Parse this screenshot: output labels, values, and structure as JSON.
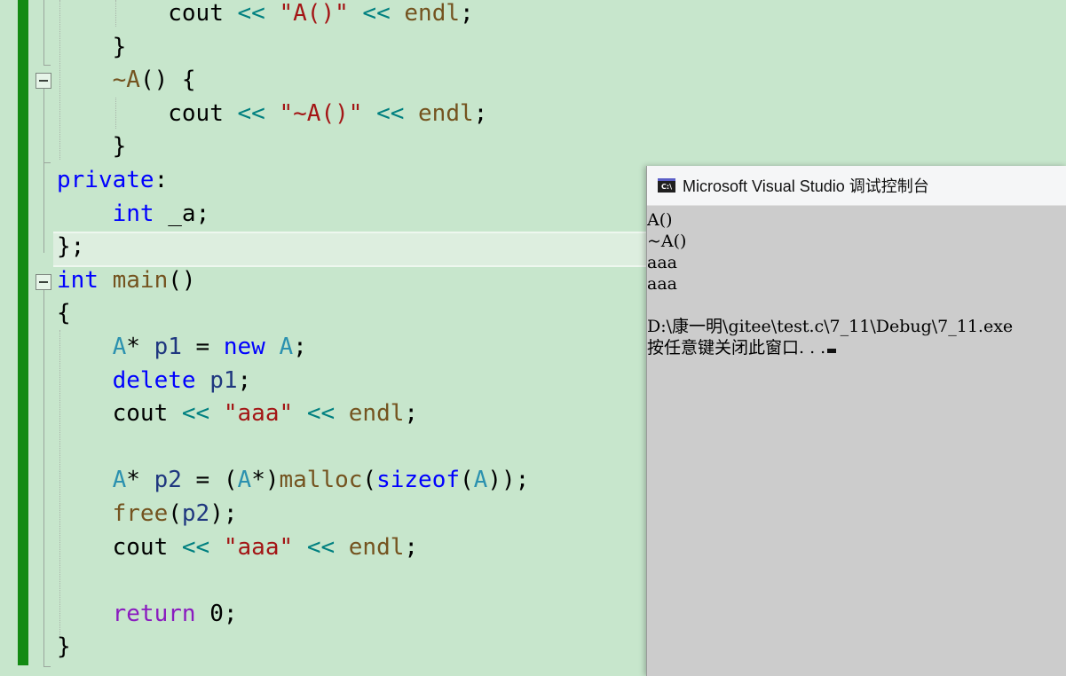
{
  "editor": {
    "lines": [
      [
        {
          "t": "        "
        },
        {
          "t": "cout",
          "c": ""
        },
        {
          "t": " "
        },
        {
          "t": "<<",
          "c": "op"
        },
        {
          "t": " "
        },
        {
          "t": "\"A()\"",
          "c": "str"
        },
        {
          "t": " "
        },
        {
          "t": "<<",
          "c": "op"
        },
        {
          "t": " "
        },
        {
          "t": "endl",
          "c": "fn"
        },
        {
          "t": ";"
        }
      ],
      [
        {
          "t": "    }"
        }
      ],
      [
        {
          "t": "    "
        },
        {
          "t": "~A",
          "c": "fn"
        },
        {
          "t": "() {"
        }
      ],
      [
        {
          "t": "        "
        },
        {
          "t": "cout"
        },
        {
          "t": " "
        },
        {
          "t": "<<",
          "c": "op"
        },
        {
          "t": " "
        },
        {
          "t": "\"~A()\"",
          "c": "str"
        },
        {
          "t": " "
        },
        {
          "t": "<<",
          "c": "op"
        },
        {
          "t": " "
        },
        {
          "t": "endl",
          "c": "fn"
        },
        {
          "t": ";"
        }
      ],
      [
        {
          "t": "    }"
        }
      ],
      [
        {
          "t": "private",
          "c": "kw"
        },
        {
          "t": ":"
        }
      ],
      [
        {
          "t": "    "
        },
        {
          "t": "int",
          "c": "kw"
        },
        {
          "t": " "
        },
        {
          "t": "_a",
          "c": ""
        },
        {
          "t": ";"
        }
      ],
      [
        {
          "t": "};"
        }
      ],
      [
        {
          "t": "int",
          "c": "kw"
        },
        {
          "t": " "
        },
        {
          "t": "main",
          "c": "fn"
        },
        {
          "t": "()"
        }
      ],
      [
        {
          "t": "{"
        }
      ],
      [
        {
          "t": "    "
        },
        {
          "t": "A",
          "c": "type"
        },
        {
          "t": "* "
        },
        {
          "t": "p1",
          "c": "var"
        },
        {
          "t": " = "
        },
        {
          "t": "new",
          "c": "kw"
        },
        {
          "t": " "
        },
        {
          "t": "A",
          "c": "type"
        },
        {
          "t": ";"
        }
      ],
      [
        {
          "t": "    "
        },
        {
          "t": "delete",
          "c": "kw"
        },
        {
          "t": " "
        },
        {
          "t": "p1",
          "c": "var"
        },
        {
          "t": ";"
        }
      ],
      [
        {
          "t": "    "
        },
        {
          "t": "cout"
        },
        {
          "t": " "
        },
        {
          "t": "<<",
          "c": "op"
        },
        {
          "t": " "
        },
        {
          "t": "\"aaa\"",
          "c": "str"
        },
        {
          "t": " "
        },
        {
          "t": "<<",
          "c": "op"
        },
        {
          "t": " "
        },
        {
          "t": "endl",
          "c": "fn"
        },
        {
          "t": ";"
        }
      ],
      [
        {
          "t": ""
        }
      ],
      [
        {
          "t": "    "
        },
        {
          "t": "A",
          "c": "type"
        },
        {
          "t": "* "
        },
        {
          "t": "p2",
          "c": "var"
        },
        {
          "t": " = ("
        },
        {
          "t": "A",
          "c": "type"
        },
        {
          "t": "*)"
        },
        {
          "t": "malloc",
          "c": "fn"
        },
        {
          "t": "("
        },
        {
          "t": "sizeof",
          "c": "kw"
        },
        {
          "t": "("
        },
        {
          "t": "A",
          "c": "type"
        },
        {
          "t": "));"
        }
      ],
      [
        {
          "t": "    "
        },
        {
          "t": "free",
          "c": "fn"
        },
        {
          "t": "("
        },
        {
          "t": "p2",
          "c": "var"
        },
        {
          "t": ");"
        }
      ],
      [
        {
          "t": "    "
        },
        {
          "t": "cout"
        },
        {
          "t": " "
        },
        {
          "t": "<<",
          "c": "op"
        },
        {
          "t": " "
        },
        {
          "t": "\"aaa\"",
          "c": "str"
        },
        {
          "t": " "
        },
        {
          "t": "<<",
          "c": "op"
        },
        {
          "t": " "
        },
        {
          "t": "endl",
          "c": "fn"
        },
        {
          "t": ";"
        }
      ],
      [
        {
          "t": ""
        }
      ],
      [
        {
          "t": "    "
        },
        {
          "t": "return",
          "c": "kw-ctrl"
        },
        {
          "t": " 0;"
        }
      ],
      [
        {
          "t": "}"
        }
      ]
    ]
  },
  "console": {
    "title": "Microsoft Visual Studio 调试控制台",
    "icon": "console-app-icon",
    "icon_text": "C:\\",
    "output": [
      "A()",
      "~A()",
      "aaa",
      "aaa",
      "",
      "D:\\康一明\\gitee\\test.c\\7_11\\Debug\\7_11.exe",
      "按任意键关闭此窗口. . ."
    ]
  }
}
